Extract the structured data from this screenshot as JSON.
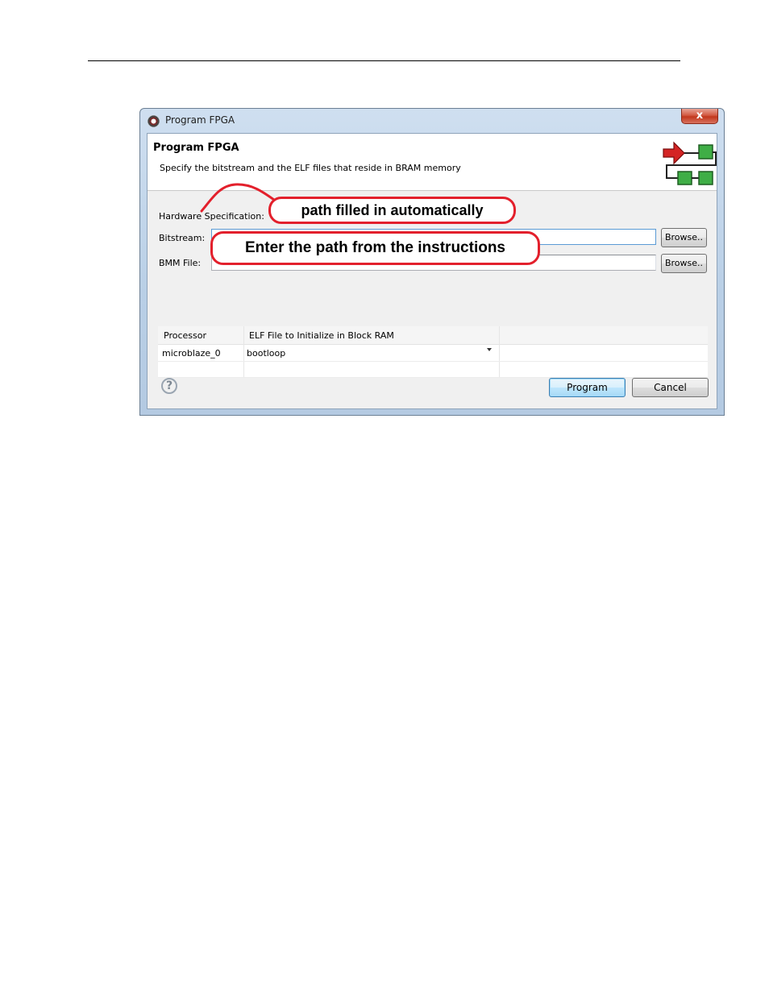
{
  "window": {
    "title": "Program FPGA",
    "close_label": "x"
  },
  "banner": {
    "title": "Program FPGA",
    "description": "Specify the bitstream and the ELF files that reside in BRAM memory"
  },
  "form": {
    "hw_spec_label": "Hardware Specification:",
    "bitstream_label": "Bitstream:",
    "bitstream_value": "",
    "bmm_label": "BMM File:",
    "bmm_value": "",
    "browse_label": "Browse.."
  },
  "table": {
    "columns": [
      "Processor",
      "ELF File to Initialize in Block RAM",
      ""
    ],
    "rows": [
      {
        "processor": "microblaze_0",
        "elf": "bootloop"
      }
    ]
  },
  "buttons": {
    "program": "Program",
    "cancel": "Cancel",
    "help": "?"
  },
  "annotations": {
    "auto_path": "path filled in automatically",
    "enter_path": "Enter the path from the instructions"
  },
  "colors": {
    "annotation_red": "#e3202c",
    "icon_green": "#2e9a3a",
    "icon_red": "#d42424"
  }
}
